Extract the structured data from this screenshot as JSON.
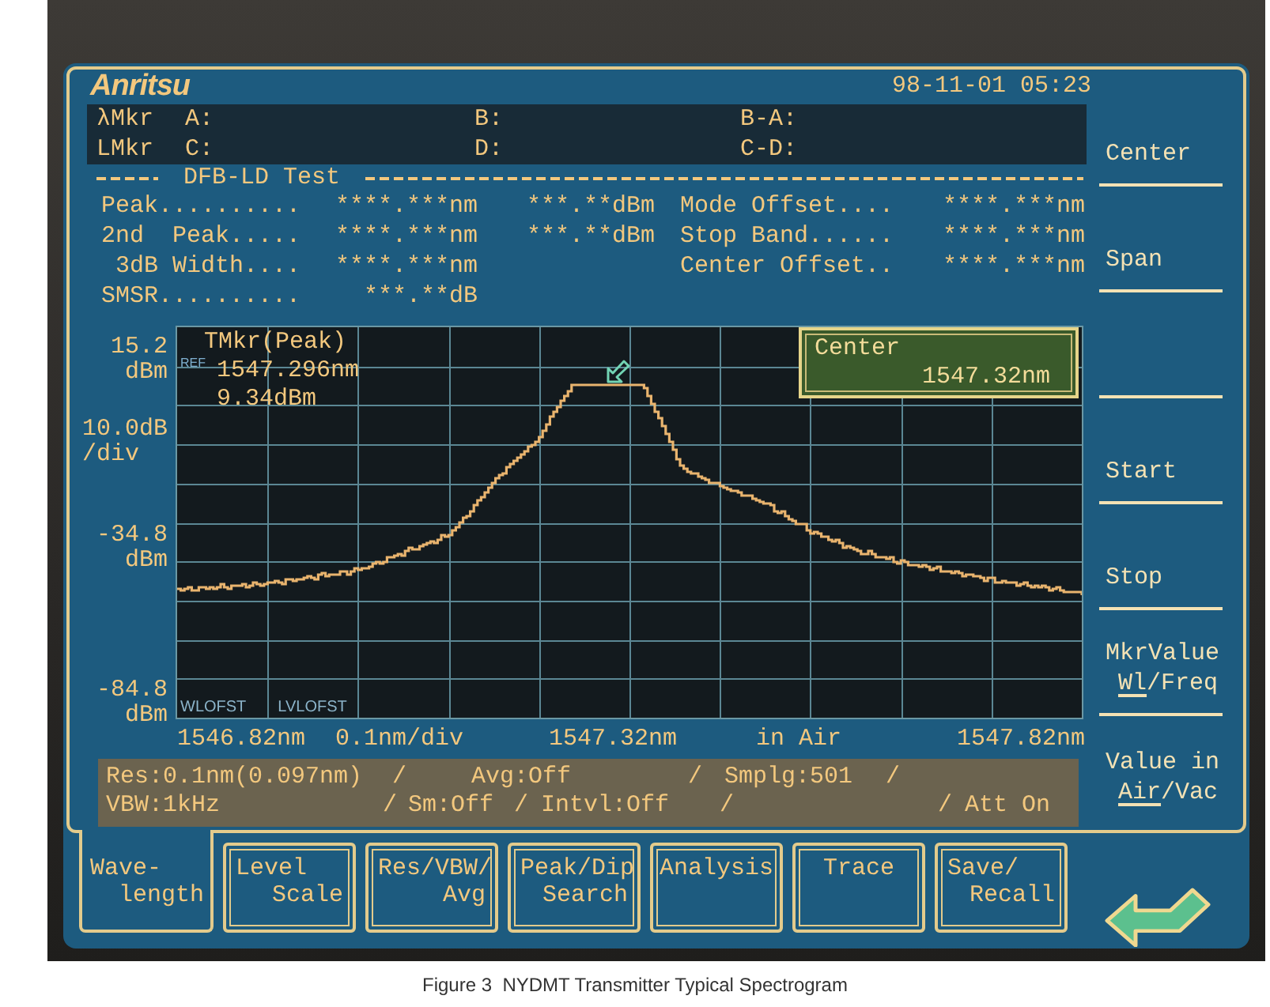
{
  "header": {
    "logo": "Anritsu",
    "datetime": "98-11-01 05:23"
  },
  "markers": [
    {
      "label": "λMkr",
      "first": "A:",
      "second": "B:",
      "difference": "B-A:"
    },
    {
      "label": "LMkr",
      "first": "C:",
      "second": "D:",
      "difference": "C-D:"
    }
  ],
  "test": {
    "title": "DFB-LD Test",
    "rows": [
      {
        "label": "Peak..........",
        "value": "****.***nm",
        "power": "***.**dBm",
        "label_2": "Mode Offset....",
        "value_2": "****.***nm"
      },
      {
        "label": "2nd  Peak.....",
        "value": "****.***nm",
        "power": "***.**dBm",
        "label_2": "Stop Band......",
        "value_2": "****.***nm"
      },
      {
        "label": "3dB Width....",
        "value": "****.***nm",
        "label_2": "Center Offset..",
        "value_2": "****.***nm"
      },
      {
        "label": "SMSR..........",
        "value": "***.**dB"
      }
    ]
  },
  "chart": {
    "y_labels": [
      {
        "value": "15.2",
        "unit": "dBm"
      },
      {
        "value": "10.0dB",
        "unit": "/div"
      },
      {
        "value": "-34.8",
        "unit": "dBm"
      },
      {
        "value": "-84.8",
        "unit": "dBm"
      }
    ],
    "ref": "REF",
    "marker": {
      "title": "TMkr(Peak)",
      "wavelength": "1547.296nm",
      "power": "9.34dBm"
    },
    "center": {
      "label": "Center",
      "value": "1547.32nm"
    },
    "offsets": [
      "WLOFST",
      "LVLOFST"
    ],
    "x_labels": [
      "1546.82nm",
      "0.1nm/div",
      "1547.32nm",
      "in Air",
      "1547.82nm"
    ]
  },
  "status": {
    "lines": [
      [
        "Res:0.1nm(0.097nm)",
        "/",
        "Avg:Off",
        "/",
        "Smplg:501",
        "/"
      ],
      [
        "VBW:1kHz",
        "/",
        "Sm:Off",
        "/",
        "Intvl:Off",
        "/",
        "/",
        "Att On"
      ]
    ]
  },
  "softkeys": [
    {
      "kind": "plain",
      "label": "Center"
    },
    {
      "kind": "plain",
      "label": "Span"
    },
    {
      "kind": "blank"
    },
    {
      "kind": "plain",
      "label": "Start"
    },
    {
      "kind": "plain",
      "label": "Stop"
    },
    {
      "kind": "toggle",
      "label": "MkrValue",
      "separator": "/",
      "options": [
        {
          "label": "Wl",
          "selected": true
        },
        {
          "label": "Freq",
          "selected": false
        }
      ]
    },
    {
      "kind": "toggle",
      "label": "Value in",
      "separator": "/",
      "options": [
        {
          "label": "Air",
          "selected": true
        },
        {
          "label": "Vac",
          "selected": false
        }
      ]
    }
  ],
  "tabs": [
    {
      "lines": [
        "Wave-",
        "length"
      ],
      "selected": true
    },
    {
      "lines": [
        "Level",
        "Scale"
      ],
      "selected": false
    },
    {
      "lines": [
        "Res/VBW/",
        "Avg"
      ],
      "selected": false
    },
    {
      "lines": [
        "Peak/Dip",
        "Search"
      ],
      "selected": false
    },
    {
      "lines": [
        "Analysis"
      ],
      "selected": false
    },
    {
      "lines": [
        "Trace"
      ],
      "selected": false
    },
    {
      "lines": [
        "Save/",
        "Recall"
      ],
      "selected": false
    }
  ],
  "caption": "Figure 3  NYDMT Transmitter Typical Spectrogram"
}
